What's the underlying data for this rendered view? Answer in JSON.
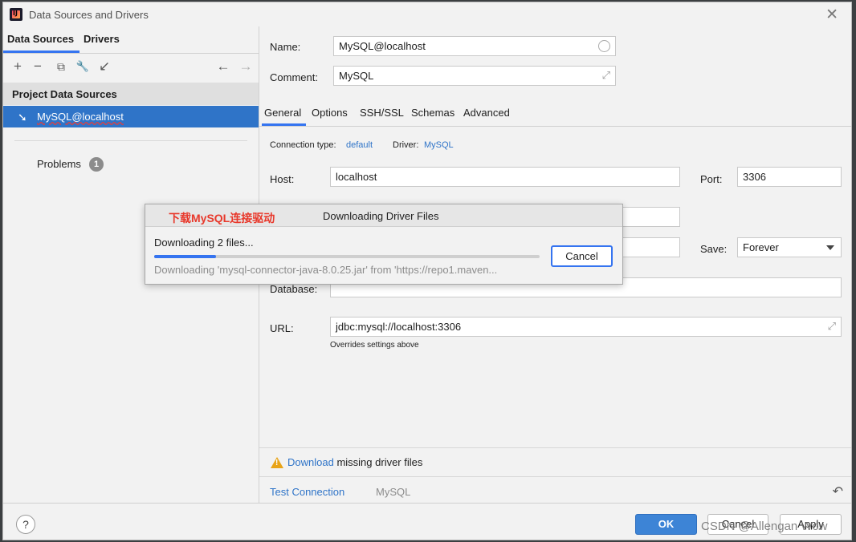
{
  "window": {
    "title": "Data Sources and Drivers"
  },
  "left": {
    "tabs": [
      "Data Sources",
      "Drivers"
    ],
    "toolbar": {
      "add": "+",
      "remove": "−",
      "copy": "⧉",
      "settings": "🔧",
      "import": "↙",
      "back": "←",
      "forward": "→"
    },
    "section_title": "Project Data Sources",
    "items": [
      {
        "label": "MySQL@localhost"
      }
    ],
    "problems": {
      "label": "Problems",
      "count": "1"
    }
  },
  "form": {
    "name_label": "Name:",
    "name_value": "MySQL@localhost",
    "comment_label": "Comment:",
    "comment_value": "MySQL",
    "tabs": [
      "General",
      "Options",
      "SSH/SSL",
      "Schemas",
      "Advanced"
    ],
    "connection_type_label": "Connection type:",
    "connection_type_value": "default",
    "driver_label": "Driver:",
    "driver_value": "MySQL",
    "host_label": "Host:",
    "host_value": "localhost",
    "port_label": "Port:",
    "port_value": "3306",
    "save_label": "Save:",
    "save_value": "Forever",
    "database_label": "Database:",
    "database_value": "",
    "url_label": "URL:",
    "url_value": "jdbc:mysql://localhost:3306",
    "url_hint": "Overrides settings above"
  },
  "warning": {
    "link": "Download",
    "text": "missing driver files"
  },
  "bottom": {
    "test_connection": "Test Connection",
    "driver_name": "MySQL"
  },
  "footer": {
    "help": "?",
    "ok": "OK",
    "cancel": "Cancel",
    "apply": "Apply",
    "watermark": "CSDN @Allengan Wow"
  },
  "download_dialog": {
    "annotation": "下载MySQL连接驱动",
    "title": "Downloading Driver Files",
    "status": "Downloading 2 files...",
    "progress": 0.16,
    "detail": "Downloading 'mysql-connector-java-8.0.25.jar' from 'https://repo1.maven...",
    "cancel": "Cancel"
  },
  "colors": {
    "accent": "#3574f0",
    "selection": "#2f74c8",
    "annotation": "#e8382b",
    "warning": "#e8a317"
  },
  "icons": [
    "app-logo-icon",
    "close-icon",
    "add-icon",
    "remove-icon",
    "copy-icon",
    "wrench-icon",
    "import-icon",
    "back-arrow-icon",
    "forward-arrow-icon",
    "mysql-dolphin-icon",
    "warning-icon",
    "undo-icon",
    "help-icon"
  ]
}
